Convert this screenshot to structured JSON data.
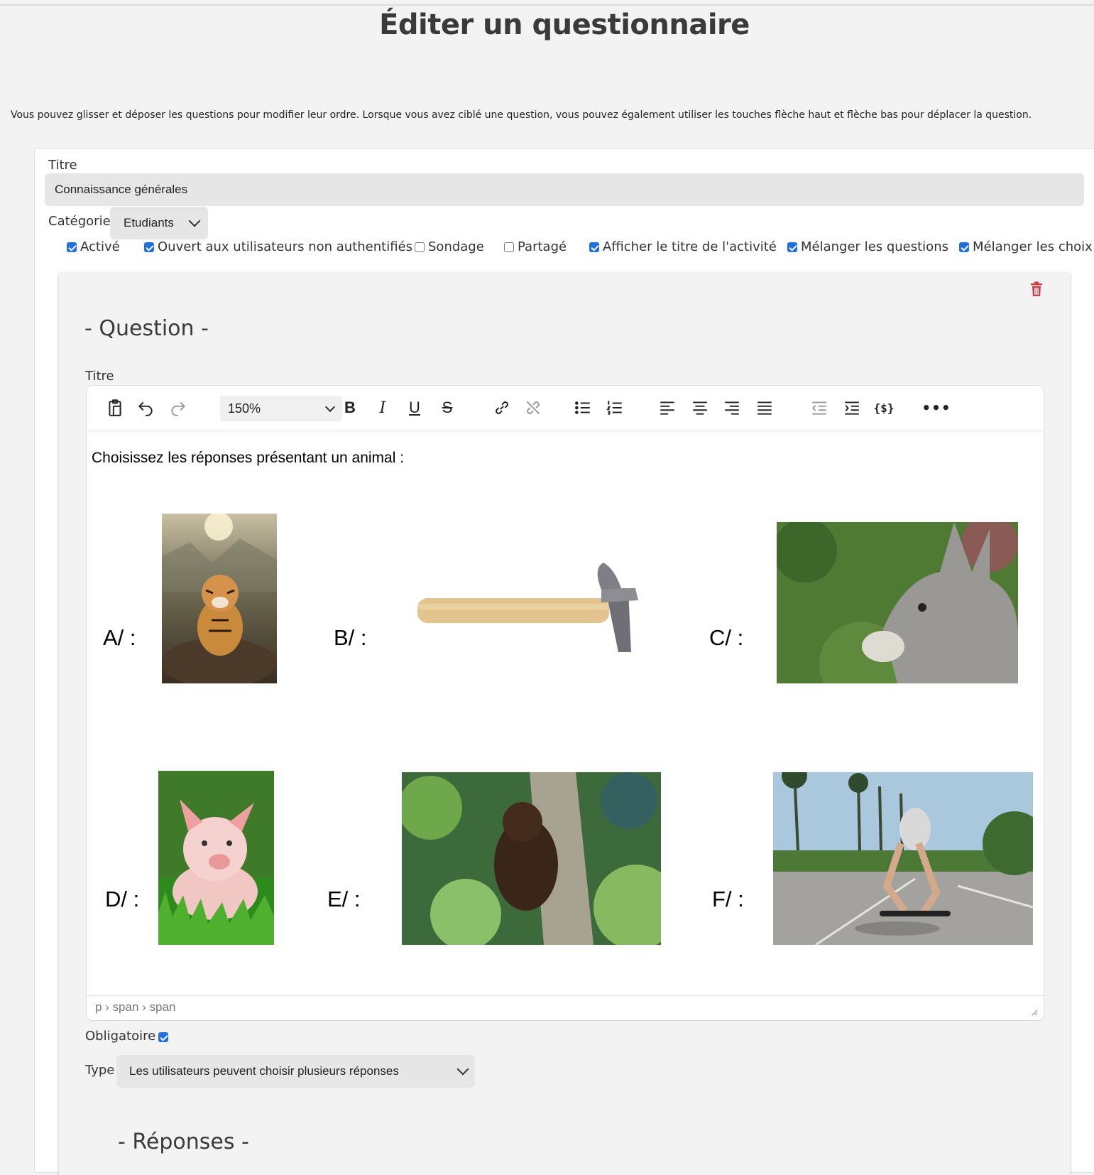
{
  "page": {
    "title": "Éditer un questionnaire",
    "hint": "Vous pouvez glisser et déposer les questions pour modifier leur ordre. Lorsque vous avez ciblé une question, vous pouvez également utiliser les touches flèche haut et flèche bas pour déplacer la question."
  },
  "form": {
    "title_label": "Titre",
    "title_value": "Connaissance générales",
    "category_label": "Catégorie",
    "category_value": "Etudiants",
    "checkboxes": [
      {
        "label": "Activé",
        "checked": true
      },
      {
        "label": "Ouvert aux utilisateurs non authentifiés",
        "checked": true
      },
      {
        "label": "Sondage",
        "checked": false
      },
      {
        "label": "Partagé",
        "checked": false
      },
      {
        "label": "Afficher le titre de l'activité",
        "checked": true
      },
      {
        "label": "Mélanger les questions",
        "checked": true
      },
      {
        "label": "Mélanger les choix",
        "checked": true
      }
    ]
  },
  "question": {
    "heading": "- Question -",
    "title_label": "Titre",
    "editor": {
      "zoom": "150%",
      "text": "Choisissez les réponses présentant un animal :",
      "options": [
        "A/ :",
        "B/ :",
        "C/ :",
        "D/ :",
        "E/ :",
        "F/ :"
      ],
      "path": "p › span › span"
    },
    "required_label": "Obligatoire",
    "required_checked": true,
    "type_label": "Type",
    "type_value": "Les utilisateurs peuvent choisir plusieurs réponses",
    "answers_heading": "- Réponses -"
  },
  "colors": {
    "accent": "#1f6fe0",
    "danger": "#d9363e"
  }
}
